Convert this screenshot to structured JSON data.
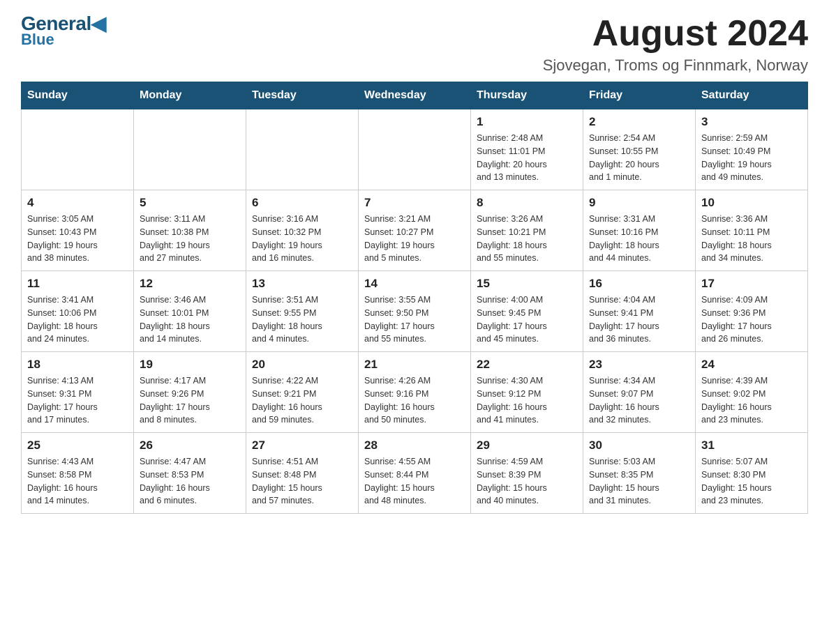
{
  "logo": {
    "general": "General",
    "blue": "Blue"
  },
  "header": {
    "title": "August 2024",
    "subtitle": "Sjovegan, Troms og Finnmark, Norway"
  },
  "days_of_week": [
    "Sunday",
    "Monday",
    "Tuesday",
    "Wednesday",
    "Thursday",
    "Friday",
    "Saturday"
  ],
  "weeks": [
    {
      "days": [
        {
          "num": "",
          "info": ""
        },
        {
          "num": "",
          "info": ""
        },
        {
          "num": "",
          "info": ""
        },
        {
          "num": "",
          "info": ""
        },
        {
          "num": "1",
          "info": "Sunrise: 2:48 AM\nSunset: 11:01 PM\nDaylight: 20 hours\nand 13 minutes."
        },
        {
          "num": "2",
          "info": "Sunrise: 2:54 AM\nSunset: 10:55 PM\nDaylight: 20 hours\nand 1 minute."
        },
        {
          "num": "3",
          "info": "Sunrise: 2:59 AM\nSunset: 10:49 PM\nDaylight: 19 hours\nand 49 minutes."
        }
      ]
    },
    {
      "days": [
        {
          "num": "4",
          "info": "Sunrise: 3:05 AM\nSunset: 10:43 PM\nDaylight: 19 hours\nand 38 minutes."
        },
        {
          "num": "5",
          "info": "Sunrise: 3:11 AM\nSunset: 10:38 PM\nDaylight: 19 hours\nand 27 minutes."
        },
        {
          "num": "6",
          "info": "Sunrise: 3:16 AM\nSunset: 10:32 PM\nDaylight: 19 hours\nand 16 minutes."
        },
        {
          "num": "7",
          "info": "Sunrise: 3:21 AM\nSunset: 10:27 PM\nDaylight: 19 hours\nand 5 minutes."
        },
        {
          "num": "8",
          "info": "Sunrise: 3:26 AM\nSunset: 10:21 PM\nDaylight: 18 hours\nand 55 minutes."
        },
        {
          "num": "9",
          "info": "Sunrise: 3:31 AM\nSunset: 10:16 PM\nDaylight: 18 hours\nand 44 minutes."
        },
        {
          "num": "10",
          "info": "Sunrise: 3:36 AM\nSunset: 10:11 PM\nDaylight: 18 hours\nand 34 minutes."
        }
      ]
    },
    {
      "days": [
        {
          "num": "11",
          "info": "Sunrise: 3:41 AM\nSunset: 10:06 PM\nDaylight: 18 hours\nand 24 minutes."
        },
        {
          "num": "12",
          "info": "Sunrise: 3:46 AM\nSunset: 10:01 PM\nDaylight: 18 hours\nand 14 minutes."
        },
        {
          "num": "13",
          "info": "Sunrise: 3:51 AM\nSunset: 9:55 PM\nDaylight: 18 hours\nand 4 minutes."
        },
        {
          "num": "14",
          "info": "Sunrise: 3:55 AM\nSunset: 9:50 PM\nDaylight: 17 hours\nand 55 minutes."
        },
        {
          "num": "15",
          "info": "Sunrise: 4:00 AM\nSunset: 9:45 PM\nDaylight: 17 hours\nand 45 minutes."
        },
        {
          "num": "16",
          "info": "Sunrise: 4:04 AM\nSunset: 9:41 PM\nDaylight: 17 hours\nand 36 minutes."
        },
        {
          "num": "17",
          "info": "Sunrise: 4:09 AM\nSunset: 9:36 PM\nDaylight: 17 hours\nand 26 minutes."
        }
      ]
    },
    {
      "days": [
        {
          "num": "18",
          "info": "Sunrise: 4:13 AM\nSunset: 9:31 PM\nDaylight: 17 hours\nand 17 minutes."
        },
        {
          "num": "19",
          "info": "Sunrise: 4:17 AM\nSunset: 9:26 PM\nDaylight: 17 hours\nand 8 minutes."
        },
        {
          "num": "20",
          "info": "Sunrise: 4:22 AM\nSunset: 9:21 PM\nDaylight: 16 hours\nand 59 minutes."
        },
        {
          "num": "21",
          "info": "Sunrise: 4:26 AM\nSunset: 9:16 PM\nDaylight: 16 hours\nand 50 minutes."
        },
        {
          "num": "22",
          "info": "Sunrise: 4:30 AM\nSunset: 9:12 PM\nDaylight: 16 hours\nand 41 minutes."
        },
        {
          "num": "23",
          "info": "Sunrise: 4:34 AM\nSunset: 9:07 PM\nDaylight: 16 hours\nand 32 minutes."
        },
        {
          "num": "24",
          "info": "Sunrise: 4:39 AM\nSunset: 9:02 PM\nDaylight: 16 hours\nand 23 minutes."
        }
      ]
    },
    {
      "days": [
        {
          "num": "25",
          "info": "Sunrise: 4:43 AM\nSunset: 8:58 PM\nDaylight: 16 hours\nand 14 minutes."
        },
        {
          "num": "26",
          "info": "Sunrise: 4:47 AM\nSunset: 8:53 PM\nDaylight: 16 hours\nand 6 minutes."
        },
        {
          "num": "27",
          "info": "Sunrise: 4:51 AM\nSunset: 8:48 PM\nDaylight: 15 hours\nand 57 minutes."
        },
        {
          "num": "28",
          "info": "Sunrise: 4:55 AM\nSunset: 8:44 PM\nDaylight: 15 hours\nand 48 minutes."
        },
        {
          "num": "29",
          "info": "Sunrise: 4:59 AM\nSunset: 8:39 PM\nDaylight: 15 hours\nand 40 minutes."
        },
        {
          "num": "30",
          "info": "Sunrise: 5:03 AM\nSunset: 8:35 PM\nDaylight: 15 hours\nand 31 minutes."
        },
        {
          "num": "31",
          "info": "Sunrise: 5:07 AM\nSunset: 8:30 PM\nDaylight: 15 hours\nand 23 minutes."
        }
      ]
    }
  ]
}
